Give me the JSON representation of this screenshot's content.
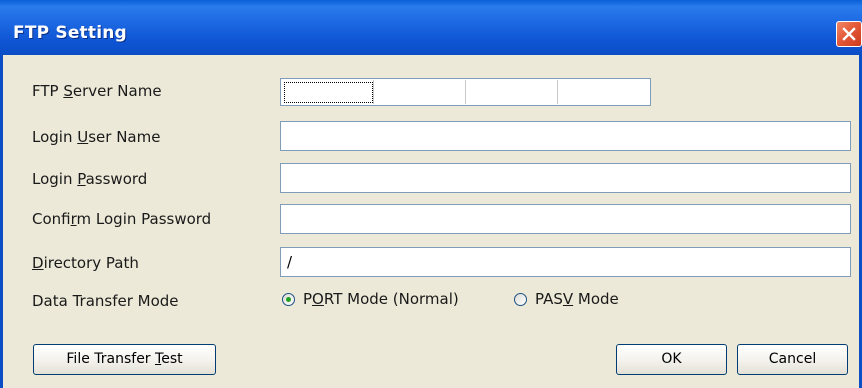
{
  "window": {
    "title": "FTP Setting"
  },
  "fields": {
    "server_name_label_pre": "FTP ",
    "server_name_label_u": "S",
    "server_name_label_post": "erver Name",
    "user_label_pre": "Login ",
    "user_label_u": "U",
    "user_label_post": "ser Name",
    "user_value": "",
    "password_label_pre": "Login ",
    "password_label_u": "P",
    "password_label_post": "assword",
    "password_value": "",
    "confirm_label_pre": "Confi",
    "confirm_label_u": "r",
    "confirm_label_post": "m Login Password",
    "confirm_value": "",
    "directory_label_u": "D",
    "directory_label_post": "irectory Path",
    "directory_value": "/",
    "mode_label": "Data Transfer Mode"
  },
  "server_ip": [
    "",
    "",
    "",
    ""
  ],
  "radios": {
    "port_pre": "P",
    "port_u": "O",
    "port_post": "RT Mode (Normal)",
    "port_selected": true,
    "pasv_pre": "PAS",
    "pasv_u": "V",
    "pasv_post": " Mode",
    "pasv_selected": false
  },
  "buttons": {
    "test_pre": "File Transfer ",
    "test_u": "T",
    "test_post": "est",
    "ok": "OK",
    "cancel": "Cancel"
  },
  "colors": {
    "titlebar": "#0b4ec6",
    "close": "#e45a38",
    "dialog_bg": "#ece9d8",
    "radio_dot": "#21a121"
  },
  "icons": {
    "close": "close-icon"
  }
}
